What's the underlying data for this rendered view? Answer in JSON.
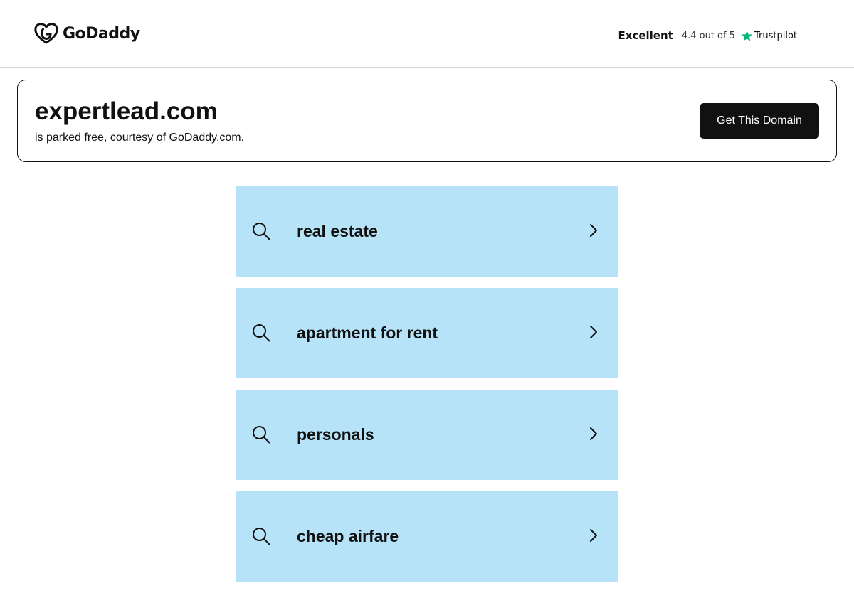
{
  "header": {
    "logo_text": "GoDaddy",
    "rating_word": "Excellent",
    "rating_score": "4.4 out of 5",
    "rating_provider": "Trustpilot",
    "star_color": "#00b67a"
  },
  "domain": {
    "name": "expertlead.com",
    "subtitle": "is parked free, courtesy of GoDaddy.com.",
    "cta_label": "Get This Domain"
  },
  "related_links": {
    "icon": "search-icon",
    "arrow_icon": "chevron-right-icon",
    "background": "#b7e3f8",
    "items": [
      {
        "label": "real estate"
      },
      {
        "label": "apartment for rent"
      },
      {
        "label": "personals"
      },
      {
        "label": "cheap airfare"
      }
    ]
  }
}
